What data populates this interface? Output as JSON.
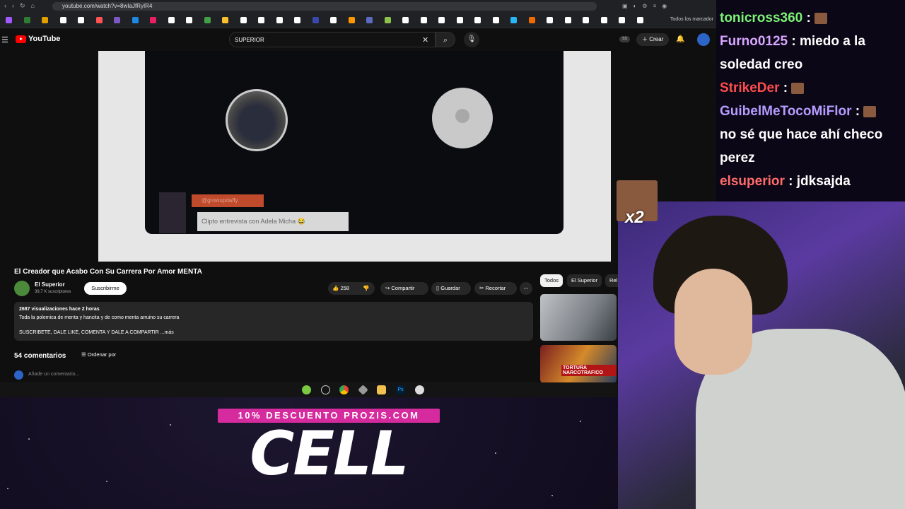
{
  "browser": {
    "url": "youtube.com/watch?v=8wIaJfRyIR4",
    "bookmarks_all": "Todos los marcador",
    "bookmark_colors": [
      "#a259ff",
      "#2e7d32",
      "#e0a000",
      "#ffffff",
      "#ffffff",
      "#ff5252",
      "#7e57c2",
      "#1e88e5",
      "#e91e63",
      "#ffffff",
      "#ffffff",
      "#43a047",
      "#fbc02d",
      "#ffffff",
      "#ffffff",
      "#ffffff",
      "#ffffff",
      "#3949ab",
      "#ffffff",
      "#ff9800",
      "#5c6bc0",
      "#8bc34a",
      "#ffffff",
      "#ffffff",
      "#ffffff",
      "#ffffff",
      "#ffffff",
      "#ffffff",
      "#29b6f6",
      "#ef6c00",
      "#ffffff",
      "#ffffff",
      "#ffffff",
      "#ffffff",
      "#ffffff",
      "#ffffff"
    ]
  },
  "youtube": {
    "logo_text": "YouTube",
    "search_value": "SUPERIOR",
    "create_label": "Crear",
    "ss_badge": "SS"
  },
  "video": {
    "user_tag": "@growupdaffy",
    "caption": "Clipto entrevista con Adela Micha 😂",
    "title": "El Creador que Acabo Con Su Carrera Por Amor MENTA",
    "channel_name": "El Superior",
    "subscribers": "39,7 K suscriptores",
    "subscribe_label": "Suscribirme",
    "likes": "258",
    "share_label": "Compartir",
    "save_label": "Guardar",
    "clip_label": "Recortar",
    "description_stats": "2687 visualizaciones  hace 2 horas",
    "description_line1": "Toda la polemica de menta y hancita y de como menta arruino su carrera",
    "description_line2": "SUSCRIBETE, DALE LIKE, COMENTA Y DALE A  COMPARTIR",
    "more_label": "...más",
    "comments_count": "54 comentarios",
    "sort_label": "Ordenar por",
    "add_comment_placeholder": "Añade un comentario..."
  },
  "sidebar": {
    "chips": [
      "Todos",
      "El Superior",
      "Rel"
    ],
    "thumb2_text": "TORTURA NARCOTRAFICO"
  },
  "chat": [
    {
      "user": "tonicross360",
      "color": "#7cf276",
      "message": ""
    },
    {
      "user": "Furno0125",
      "color": "#d8a6ff",
      "message": "miedo a la"
    },
    {
      "user": "",
      "color": "#ffffff",
      "message": "soledad creo"
    },
    {
      "user": "StrikeDer",
      "color": "#ff4d4d",
      "message": ""
    },
    {
      "user": "GuibelMeTocoMiFlor",
      "color": "#b59cff",
      "message": ""
    },
    {
      "user": "",
      "color": "#ffffff",
      "message": "no sé que hace ahí checo"
    },
    {
      "user": "",
      "color": "#ffffff",
      "message": "perez"
    },
    {
      "user": "elsuperior",
      "color": "#ff6b6b",
      "message": "jdksajda"
    }
  ],
  "overlay": {
    "x2": "x2",
    "promo": "10% DESCUENTO PROZIS.COM",
    "big_text": "CELL"
  }
}
